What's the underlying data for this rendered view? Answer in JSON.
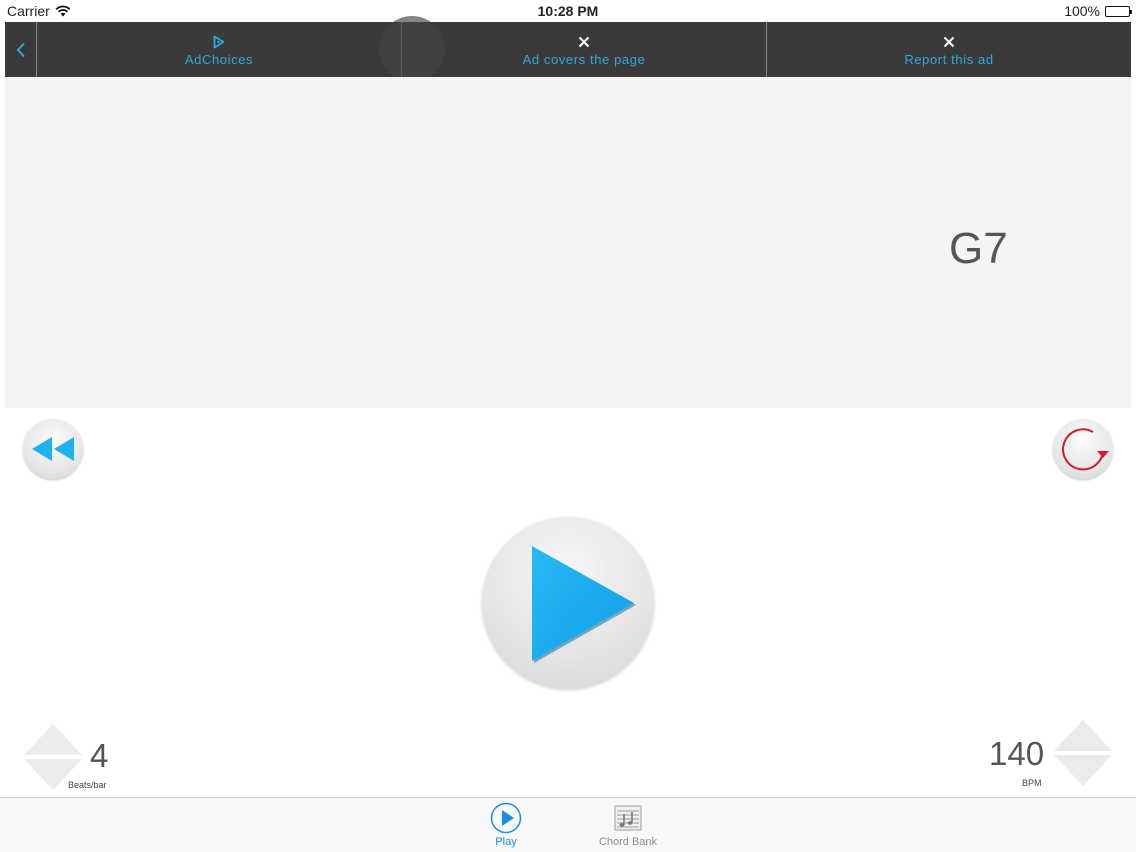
{
  "status_bar": {
    "carrier": "Carrier",
    "time": "10:28 PM",
    "battery": "100%"
  },
  "ad_bar": {
    "items": [
      {
        "label": "AdChoices",
        "icon": "adchoices-icon"
      },
      {
        "label": "Ad covers the page",
        "icon": "close-icon"
      },
      {
        "label": "Report this ad",
        "icon": "close-icon"
      }
    ],
    "accent": "#34a8dc"
  },
  "chord_display": {
    "chord": "G7"
  },
  "controls": {
    "rewind_icon": "rewind-icon",
    "loop_icon": "loop-icon",
    "play_icon": "play-icon"
  },
  "beats": {
    "value": "4",
    "label": "Beats/bar"
  },
  "tempo": {
    "value": "140",
    "label": "BPM"
  },
  "tab_bar": {
    "tabs": [
      {
        "label": "Play",
        "icon": "play-circle-icon",
        "selected": true
      },
      {
        "label": "Chord Bank",
        "icon": "sheet-music-icon",
        "selected": false
      }
    ]
  },
  "colors": {
    "play_blue": "#1fb0f0",
    "loop_red": "#d0202a"
  }
}
